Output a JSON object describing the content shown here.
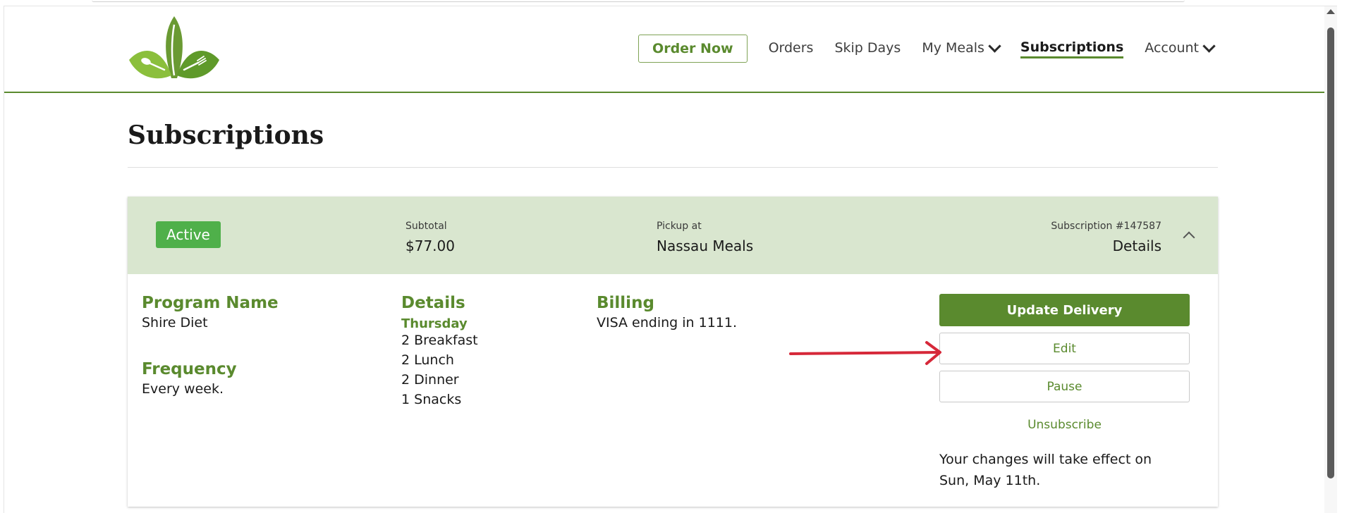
{
  "nav": {
    "order_now": "Order Now",
    "orders": "Orders",
    "skip_days": "Skip Days",
    "my_meals": "My Meals",
    "subscriptions": "Subscriptions",
    "account": "Account"
  },
  "page": {
    "title": "Subscriptions"
  },
  "subscription": {
    "status": "Active",
    "subtotal_label": "Subtotal",
    "subtotal_value": "$77.00",
    "pickup_label": "Pickup at",
    "pickup_value": "Nassau Meals",
    "number_label": "Subscription #147587",
    "details_link": "Details",
    "program_title": "Program Name",
    "program_value": "Shire Diet",
    "frequency_title": "Frequency",
    "frequency_value": "Every week.",
    "details_title": "Details",
    "day": "Thursday",
    "meals": [
      "2 Breakfast",
      "2 Lunch",
      "2 Dinner",
      "1 Snacks"
    ],
    "billing_title": "Billing",
    "billing_value": "VISA ending in 1111.",
    "update_delivery": "Update Delivery",
    "edit": "Edit",
    "pause": "Pause",
    "unsubscribe": "Unsubscribe",
    "note_line1": "Your changes will take effect on",
    "note_line2": "Sun, May 11th."
  },
  "colors": {
    "brand_green": "#5a8a2e",
    "active_badge": "#4fb04a",
    "card_header": "#d9e6cf",
    "annotation_arrow": "#d62839"
  }
}
